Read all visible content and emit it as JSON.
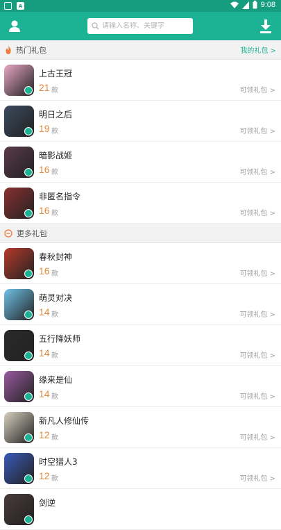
{
  "status": {
    "time": "9:08"
  },
  "header": {
    "search_placeholder": "请输入名称、关键字"
  },
  "hot_section": {
    "title": "热门礼包",
    "more_label": "我的礼包 >"
  },
  "more_section": {
    "title": "更多礼包"
  },
  "claim_label": "可领礼包 >",
  "unit_label": "款",
  "hot_games": [
    {
      "name": "上古王冠",
      "count": "21",
      "color": "#e8a6c4"
    },
    {
      "name": "明日之后",
      "count": "19",
      "color": "#3b4a5e"
    },
    {
      "name": "暗影战姬",
      "count": "16",
      "color": "#5a3a4a"
    },
    {
      "name": "非匿名指令",
      "count": "16",
      "color": "#8a3030"
    }
  ],
  "more_games": [
    {
      "name": "春秋封神",
      "count": "16",
      "color": "#b53a2a"
    },
    {
      "name": "萌灵对决",
      "count": "14",
      "color": "#6fc2e8"
    },
    {
      "name": "五行降妖师",
      "count": "14",
      "color": "#2a2a2a"
    },
    {
      "name": "缘来是仙",
      "count": "14",
      "color": "#9a5aa0"
    },
    {
      "name": "新凡人修仙传",
      "count": "12",
      "color": "#d8d0c0"
    },
    {
      "name": "时空猎人3",
      "count": "12",
      "color": "#3a5ab8"
    },
    {
      "name": "剑逆",
      "count": "",
      "color": "#4a3a3a"
    }
  ]
}
